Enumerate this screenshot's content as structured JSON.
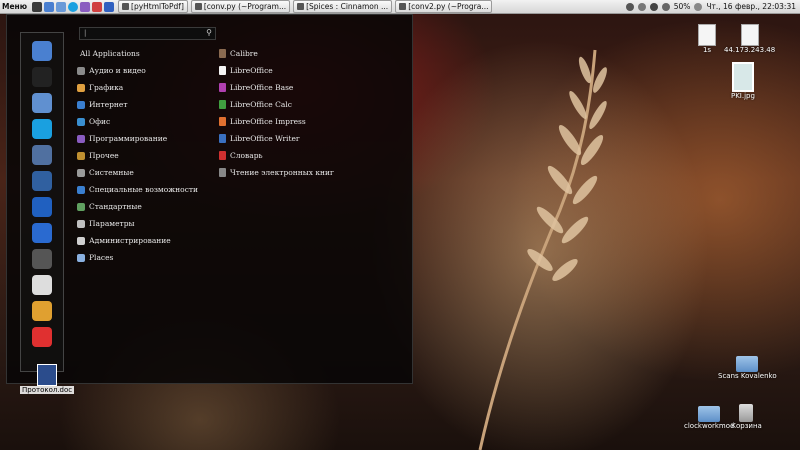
{
  "panel": {
    "menu_label": "Меню",
    "windows": [
      {
        "title": "[pyHtmlToPdf]"
      },
      {
        "title": "[conv.py (~Program..."
      },
      {
        "title": "[Spices : Cinnamon ..."
      },
      {
        "title": "[conv2.py (~Progra..."
      }
    ],
    "battery": "50%",
    "clock": "Чт., 16 февр., 22:03:31"
  },
  "startmenu": {
    "search_caret": "|",
    "categories": [
      {
        "label": "All Applications",
        "color": "#000000"
      },
      {
        "label": "Аудио и видео",
        "color": "#8a8a8a"
      },
      {
        "label": "Графика",
        "color": "#e0a040"
      },
      {
        "label": "Интернет",
        "color": "#3a7fd0"
      },
      {
        "label": "Офис",
        "color": "#3a8fd0"
      },
      {
        "label": "Программирование",
        "color": "#8a5cc0"
      },
      {
        "label": "Прочее",
        "color": "#c09030"
      },
      {
        "label": "Системные",
        "color": "#9a9a9a"
      },
      {
        "label": "Специальные возможности",
        "color": "#3a7fd0"
      },
      {
        "label": "Стандартные",
        "color": "#60a060"
      },
      {
        "label": "Параметры",
        "color": "#c0c0c0"
      },
      {
        "label": "Администрирование",
        "color": "#d0d0d0"
      },
      {
        "label": "Places",
        "color": "#8ab0e0"
      }
    ],
    "apps": [
      {
        "label": "Calibre",
        "color": "#8a6a50"
      },
      {
        "label": "LibreOffice",
        "color": "#f4f4f4"
      },
      {
        "label": "LibreOffice Base",
        "color": "#b040b0"
      },
      {
        "label": "LibreOffice Calc",
        "color": "#40a040"
      },
      {
        "label": "LibreOffice Impress",
        "color": "#e07030"
      },
      {
        "label": "LibreOffice Writer",
        "color": "#3a70c0"
      },
      {
        "label": "Словарь",
        "color": "#d03030"
      },
      {
        "label": "Чтение электронных книг",
        "color": "#888888"
      }
    ],
    "favorites": [
      {
        "name": "chromium-icon",
        "color": "#4a80d0"
      },
      {
        "name": "terminal-icon",
        "color": "#222222"
      },
      {
        "name": "file-manager-icon",
        "color": "#6090d0"
      },
      {
        "name": "skype-icon",
        "color": "#1aa0e0"
      },
      {
        "name": "virtualbox-icon",
        "color": "#5070a0"
      },
      {
        "name": "sublime-icon",
        "color": "#3060a0"
      },
      {
        "name": "teamviewer-icon",
        "color": "#2060c0"
      },
      {
        "name": "player-icon",
        "color": "#2a6ad0"
      },
      {
        "name": "system-icon",
        "color": "#555555"
      },
      {
        "name": "lock-icon",
        "color": "#dddddd"
      },
      {
        "name": "logout-icon",
        "color": "#e0a030"
      },
      {
        "name": "power-icon",
        "color": "#e03030"
      }
    ]
  },
  "desktop": {
    "right_top": [
      {
        "label": "1s"
      },
      {
        "label": "44.173.243.48"
      },
      {
        "label": "PKI.jpg"
      }
    ],
    "folders": [
      {
        "label": "Scans Kovalenko"
      },
      {
        "label": "clockworkmod"
      },
      {
        "label": "Корзина"
      }
    ],
    "left_file": {
      "label": "Протокол.doc"
    }
  }
}
